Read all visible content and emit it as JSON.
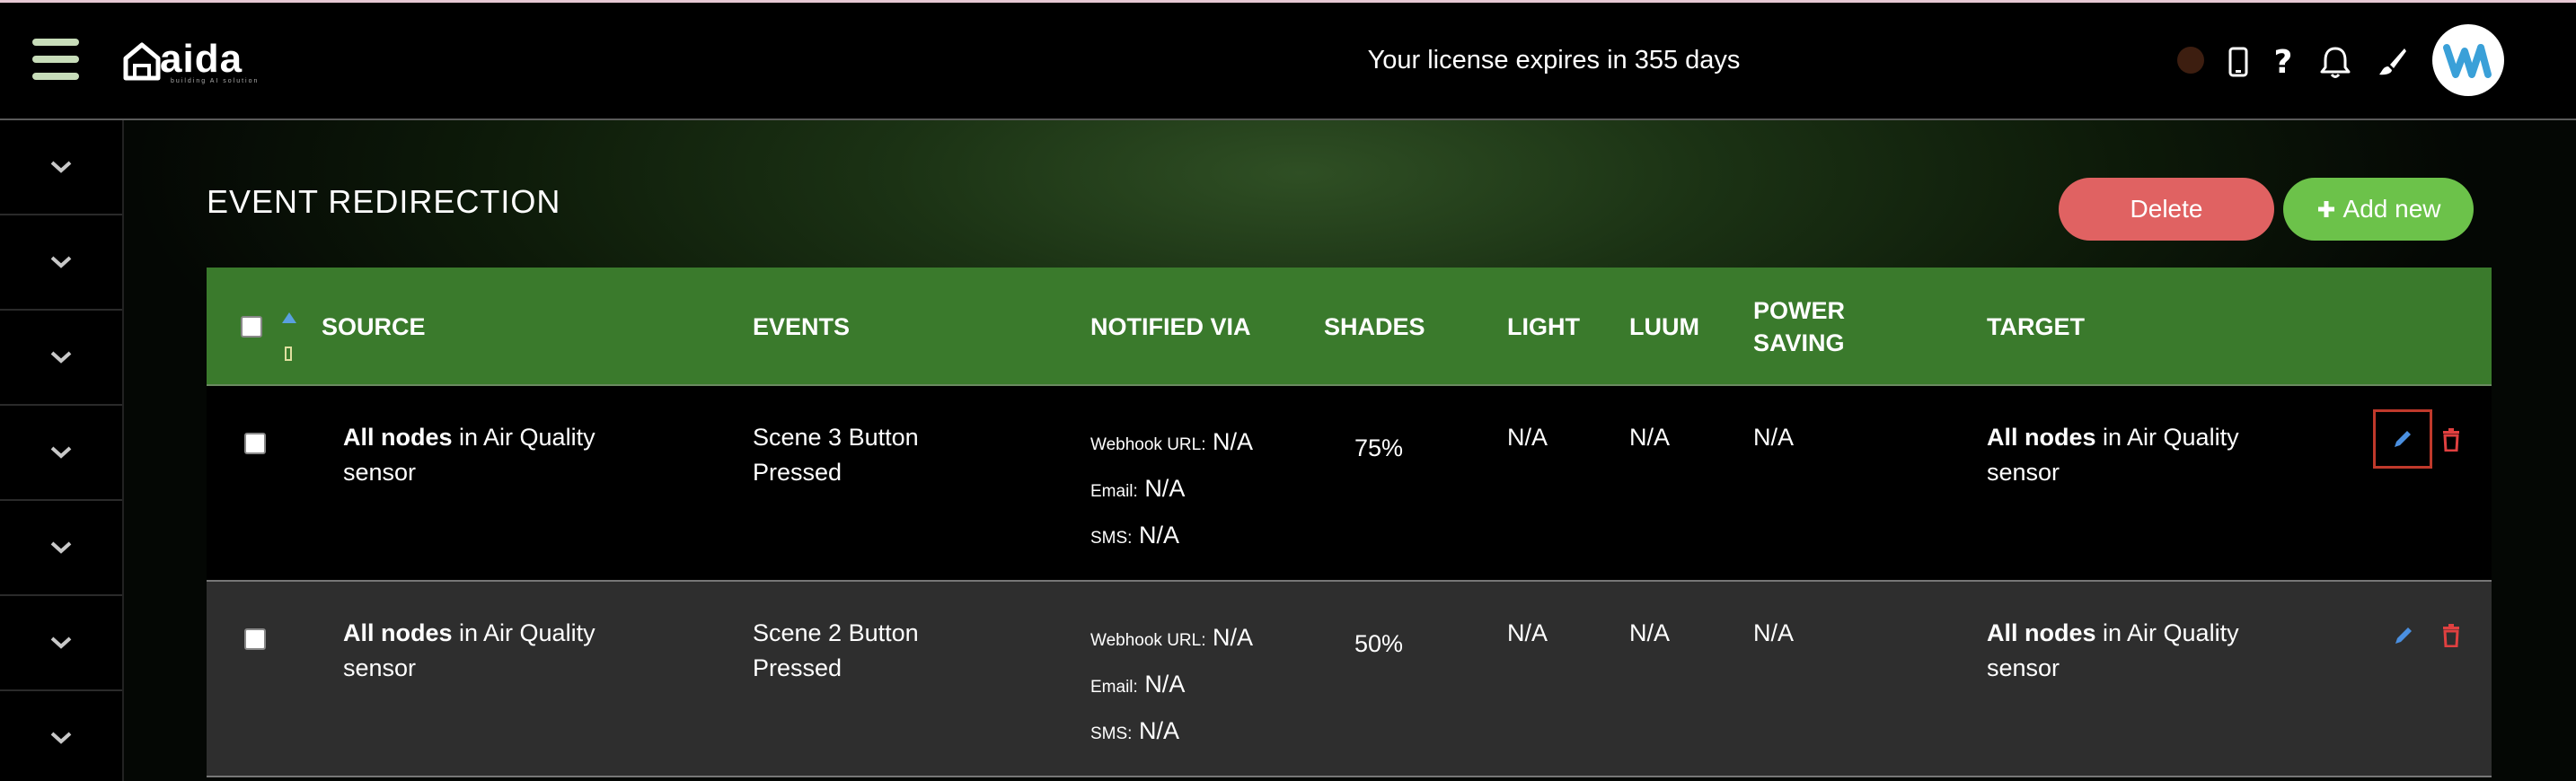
{
  "header": {
    "logo_text": "aida",
    "logo_subtext": "building AI solution",
    "license_text": "Your license expires in 355 days",
    "icons": [
      "menu-icon",
      "status-dot",
      "phone-icon",
      "help-icon",
      "bell-icon",
      "brush-icon",
      "avatar"
    ],
    "status_color": "#3d1e10"
  },
  "sidebar": {
    "items": [
      {
        "icon": "chevron-down-icon"
      },
      {
        "icon": "chevron-down-icon"
      },
      {
        "icon": "chevron-down-icon"
      },
      {
        "icon": "chevron-down-icon"
      },
      {
        "icon": "chevron-down-icon"
      },
      {
        "icon": "chevron-down-icon"
      },
      {
        "icon": "chevron-down-icon"
      }
    ]
  },
  "page": {
    "title": "EVENT REDIRECTION",
    "delete_label": "Delete",
    "add_label": "Add new",
    "colors": {
      "delete": "#e06262",
      "add": "#6cc24a",
      "header": "#3a7a2c"
    }
  },
  "table": {
    "columns": {
      "source": "SOURCE",
      "events": "EVENTS",
      "notified_via": "NOTIFIED VIA",
      "shades": "SHADES",
      "light": "LIGHT",
      "luum": "LUUM",
      "power_saving_1": "POWER",
      "power_saving_2": "SAVING",
      "target": "TARGET"
    },
    "rows": [
      {
        "source_bold": "All nodes",
        "source_rest": " in Air Quality",
        "source_line2": "sensor",
        "event_line1": "Scene 3 Button",
        "event_line2": "Pressed",
        "webhook_label": "Webhook URL:",
        "webhook_value": "N/A",
        "email_label": "Email:",
        "email_value": "N/A",
        "sms_label": "SMS:",
        "sms_value": "N/A",
        "shades": "75%",
        "light": "N/A",
        "luum": "N/A",
        "power_saving": "N/A",
        "target_bold": "All nodes",
        "target_rest": " in Air Quality",
        "target_line2": "sensor"
      },
      {
        "source_bold": "All nodes",
        "source_rest": " in Air Quality",
        "source_line2": "sensor",
        "event_line1": "Scene 2 Button",
        "event_line2": "Pressed",
        "webhook_label": "Webhook URL:",
        "webhook_value": "N/A",
        "email_label": "Email:",
        "email_value": "N/A",
        "sms_label": "SMS:",
        "sms_value": "N/A",
        "shades": "50%",
        "light": "N/A",
        "luum": "N/A",
        "power_saving": "N/A",
        "target_bold": "All nodes",
        "target_rest": " in Air Quality",
        "target_line2": "sensor"
      }
    ]
  }
}
